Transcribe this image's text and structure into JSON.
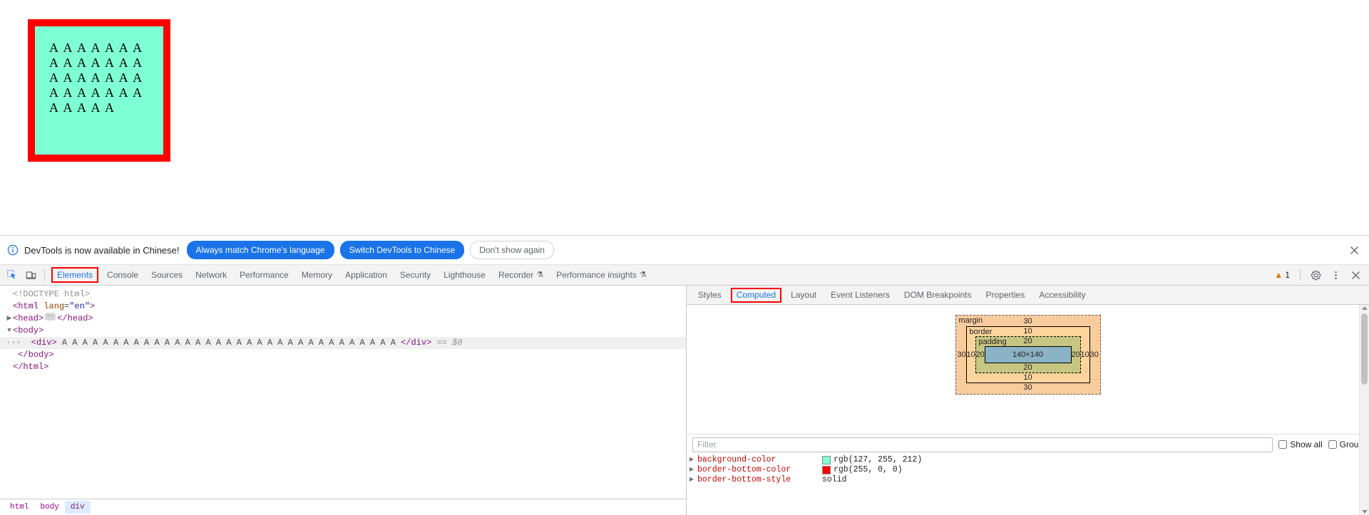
{
  "page": {
    "box_text": "A A A A A A A A A A A A A A A A A A A A A A A A A A A A A A A A A"
  },
  "infobar": {
    "icon": "info-circle-icon",
    "message": "DevTools is now available in Chinese!",
    "primary_button": "Always match Chrome's language",
    "secondary_button": "Switch DevTools to Chinese",
    "dismiss_button": "Don't show again",
    "close_icon": "close-icon"
  },
  "toolbar": {
    "inspect_icon": "inspect-element-icon",
    "device_icon": "device-toolbar-icon",
    "tabs": [
      {
        "label": "Elements",
        "selected": true,
        "beaker": false
      },
      {
        "label": "Console",
        "selected": false,
        "beaker": false
      },
      {
        "label": "Sources",
        "selected": false,
        "beaker": false
      },
      {
        "label": "Network",
        "selected": false,
        "beaker": false
      },
      {
        "label": "Performance",
        "selected": false,
        "beaker": false
      },
      {
        "label": "Memory",
        "selected": false,
        "beaker": false
      },
      {
        "label": "Application",
        "selected": false,
        "beaker": false
      },
      {
        "label": "Security",
        "selected": false,
        "beaker": false
      },
      {
        "label": "Lighthouse",
        "selected": false,
        "beaker": false
      },
      {
        "label": "Recorder",
        "selected": false,
        "beaker": true
      },
      {
        "label": "Performance insights",
        "selected": false,
        "beaker": true
      }
    ],
    "warning_count": "1",
    "warning_icon": "warning-triangle-icon",
    "settings_icon": "gear-icon",
    "more_icon": "more-vertical-icon",
    "close_icon": "close-icon"
  },
  "dom": {
    "lines": [
      {
        "indent": 0,
        "twisty": "",
        "gutter": "",
        "type": "doctype",
        "text": "<!DOCTYPE html>"
      },
      {
        "indent": 0,
        "twisty": "",
        "gutter": "",
        "type": "tag_open",
        "tag": "html",
        "attr_name": "lang",
        "attr_value": "\"en\""
      },
      {
        "indent": 1,
        "twisty": "▶",
        "gutter": "",
        "type": "collapsed",
        "tag": "head"
      },
      {
        "indent": 1,
        "twisty": "▼",
        "gutter": "",
        "type": "tag_plain",
        "tag": "body"
      },
      {
        "indent": 2,
        "twisty": "",
        "gutter": "···",
        "type": "element_with_text",
        "tag": "div",
        "text": "A A A A A A A A A A A A A A A A A A A A A A A A A A A A A A A A A",
        "suffix": "== $0",
        "selected": true
      },
      {
        "indent": 1,
        "twisty": "",
        "gutter": "",
        "type": "tag_close",
        "tag": "body"
      },
      {
        "indent": 0,
        "twisty": "",
        "gutter": "",
        "type": "tag_close",
        "tag": "html"
      }
    ]
  },
  "breadcrumb": {
    "items": [
      {
        "label": "html",
        "active": false
      },
      {
        "label": "body",
        "active": false
      },
      {
        "label": "div",
        "active": true
      }
    ]
  },
  "sidebar": {
    "tabs": [
      {
        "label": "Styles",
        "selected": false
      },
      {
        "label": "Computed",
        "selected": true
      },
      {
        "label": "Layout",
        "selected": false
      },
      {
        "label": "Event Listeners",
        "selected": false
      },
      {
        "label": "DOM Breakpoints",
        "selected": false
      },
      {
        "label": "Properties",
        "selected": false
      },
      {
        "label": "Accessibility",
        "selected": false
      }
    ],
    "box_model": {
      "margin_label": "margin",
      "margin_top": "30",
      "margin_right": "30",
      "margin_bottom": "30",
      "margin_left": "30",
      "border_label": "border",
      "border_top": "10",
      "border_right": "10",
      "border_bottom": "10",
      "border_left": "10",
      "padding_label": "padding",
      "padding_top": "20",
      "padding_right": "20",
      "padding_bottom": "20",
      "padding_left": "20",
      "content_size": "140×140",
      "colors": {
        "margin": "#f9cc9d",
        "border": "#fdd49c",
        "padding": "#c6c582",
        "content": "#8cb3c5"
      }
    },
    "filter": {
      "placeholder": "Filter",
      "value": "",
      "show_all_label": "Show all",
      "show_all_checked": false,
      "group_label": "Group",
      "group_checked": false
    },
    "properties": [
      {
        "name": "background-color",
        "value": "rgb(127, 255, 212)",
        "swatch": "#7fffd4"
      },
      {
        "name": "border-bottom-color",
        "value": "rgb(255, 0, 0)",
        "swatch": "#ff0000"
      },
      {
        "name": "border-bottom-style",
        "value": "solid",
        "swatch": ""
      }
    ]
  }
}
